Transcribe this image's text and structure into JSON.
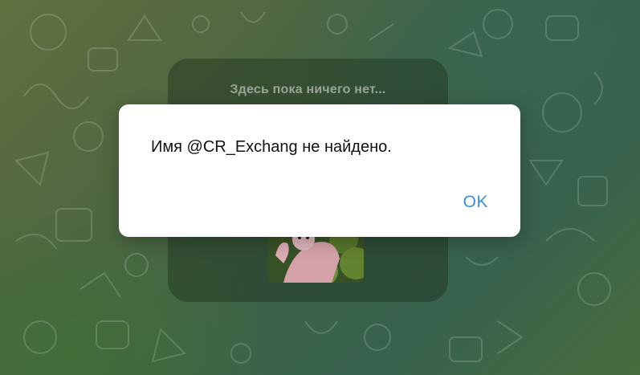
{
  "chat": {
    "empty_state_title": "Здесь пока ничего нет..."
  },
  "dialog": {
    "message": "Имя @CR_Exchang не найдено.",
    "ok_label": "OK"
  },
  "colors": {
    "accent": "#3a8fd6",
    "dialog_bg": "#ffffff",
    "background_green": "#3f6b52"
  },
  "icons": {
    "sticker": "greeting-sticker"
  }
}
